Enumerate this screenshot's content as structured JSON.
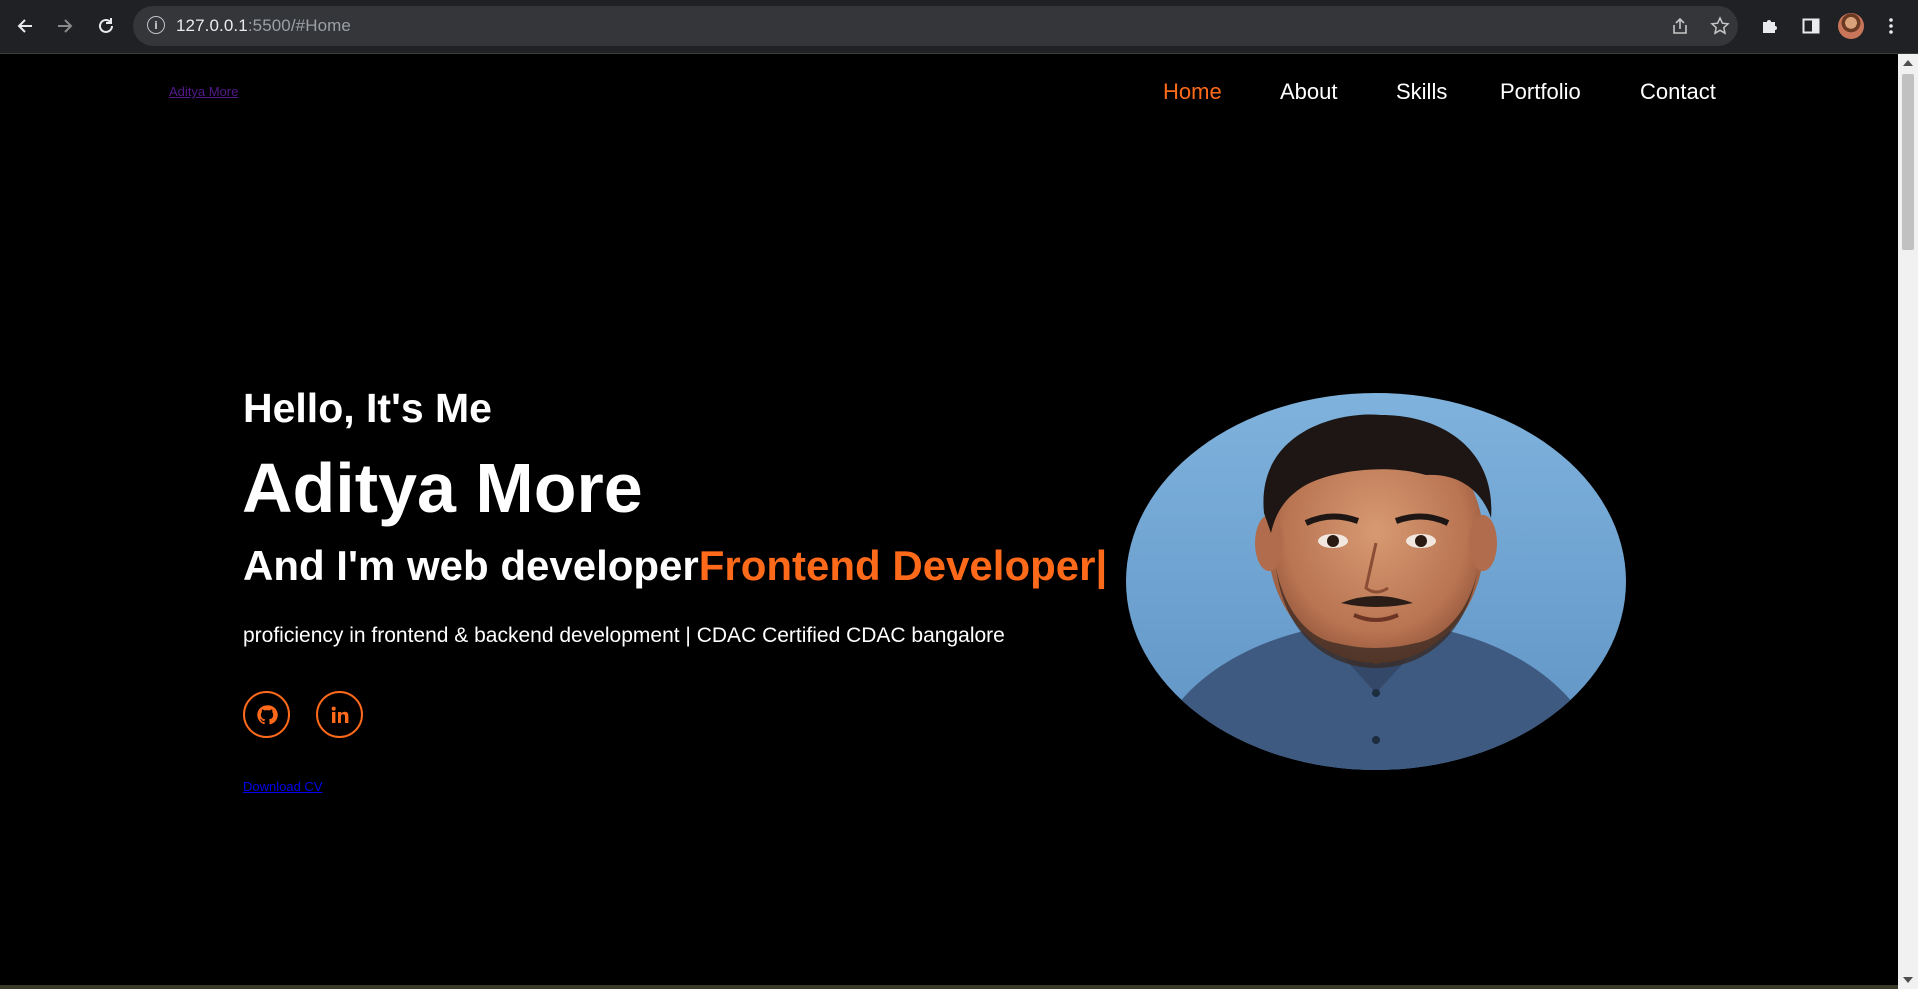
{
  "browser": {
    "url_host": "127.0.0.1",
    "url_rest": ":5500/#Home",
    "back_icon": "arrow-left-icon",
    "forward_icon": "arrow-right-icon",
    "reload_icon": "reload-icon"
  },
  "site": {
    "logo": "Aditya More",
    "nav": [
      "Home",
      "About",
      "Skills",
      "Portfolio",
      "Contact"
    ],
    "active_nav": "Home",
    "accent_color": "#ff6a1a",
    "background_color": "#000000"
  },
  "hero": {
    "greeting": "Hello, It's Me",
    "name": "Aditya More",
    "role_static": "And I'm web developer",
    "role_typed": "Frontend Developer|",
    "tagline": "proficiency in frontend & backend development | CDAC Certified CDAC bangalore",
    "social": [
      {
        "name": "GitHub",
        "icon": "github-icon"
      },
      {
        "name": "LinkedIn",
        "icon": "linkedin-icon"
      }
    ],
    "download_label": "Download CV",
    "portrait_icon": "profile-photo"
  }
}
